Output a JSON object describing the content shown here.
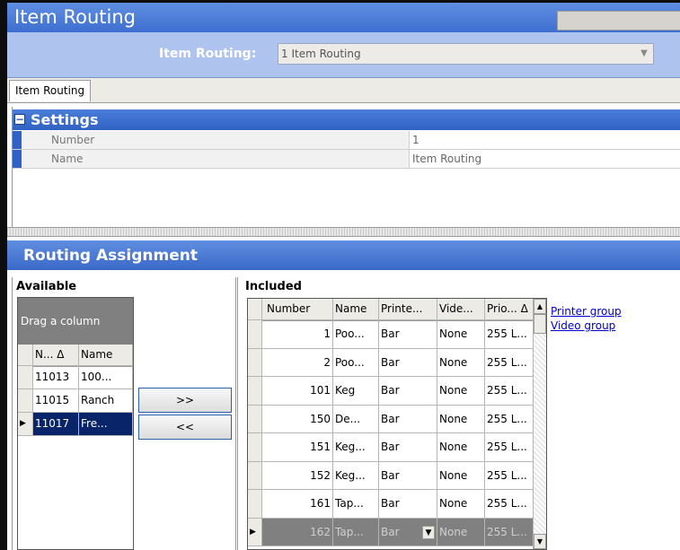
{
  "window": {
    "title": "Item Routing"
  },
  "selector": {
    "label": "Item Routing:",
    "value": "1 Item Routing"
  },
  "tabs": [
    {
      "label": "Item Routing"
    }
  ],
  "settings": {
    "header": "Settings",
    "rows": [
      {
        "name": "Number",
        "value": "1"
      },
      {
        "name": "Name",
        "value": "Item Routing"
      }
    ]
  },
  "routing": {
    "header": "Routing Assignment",
    "available": {
      "caption": "Available",
      "drag_hint": "Drag a column",
      "columns": [
        "N... Δ",
        "Name"
      ],
      "rows": [
        [
          "11013",
          "100..."
        ],
        [
          "11015",
          "Ranch"
        ],
        [
          "11017",
          "Fre..."
        ]
      ]
    },
    "buttons": {
      "add": ">>",
      "remove": "<<"
    },
    "included": {
      "caption": "Included",
      "columns": [
        "Number",
        "Name",
        "Printe...",
        "Vide...",
        "Prio... Δ"
      ],
      "rows": [
        [
          "1",
          "Poo...",
          "Bar",
          "None",
          "255 L..."
        ],
        [
          "2",
          "Poo...",
          "Bar",
          "None",
          "255 L..."
        ],
        [
          "101",
          "Keg",
          "Bar",
          "None",
          "255 L..."
        ],
        [
          "150",
          "De...",
          "Bar",
          "None",
          "255 L..."
        ],
        [
          "151",
          "Keg...",
          "Bar",
          "None",
          "255 L..."
        ],
        [
          "152",
          "Keg...",
          "Bar",
          "None",
          "255 L..."
        ],
        [
          "161",
          "Tap...",
          "Bar",
          "None",
          "255 L..."
        ],
        [
          "162",
          "Tap...",
          "Bar",
          "None",
          "255 L..."
        ]
      ]
    },
    "links": {
      "printer_group": "Printer group",
      "video_group": "Video group"
    }
  },
  "colors": {
    "accent": "#3e6fd0",
    "selection": "#0a246a",
    "link": "#0000d0"
  }
}
